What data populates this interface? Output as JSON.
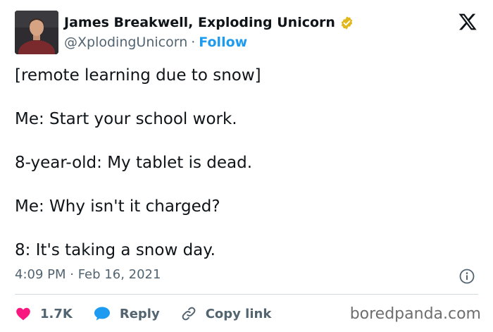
{
  "author": {
    "display_name": "James Breakwell, Exploding Unicorn",
    "handle": "@XplodingUnicorn",
    "separator": "·",
    "follow_label": "Follow"
  },
  "tweet": {
    "lines": [
      "[remote learning due to snow]",
      "Me: Start your school work.",
      "8-year-old: My tablet is dead.",
      "Me: Why isn't it charged?",
      "8: It's taking a snow day."
    ],
    "timestamp": "4:09 PM · Feb 16, 2021"
  },
  "actions": {
    "like_count": "1.7K",
    "reply_label": "Reply",
    "copy_link_label": "Copy link"
  },
  "watermark": "boredpanda.com",
  "icons": {
    "brand": "x-logo-icon",
    "verified": "verified-badge-icon",
    "info": "info-icon",
    "like": "heart-icon",
    "reply": "speech-bubble-icon",
    "copy": "link-icon"
  },
  "colors": {
    "accent": "#1d9bf0",
    "like": "#f91880",
    "verified_gold": "#e2b719",
    "text": "#0f1419",
    "muted": "#536471"
  }
}
